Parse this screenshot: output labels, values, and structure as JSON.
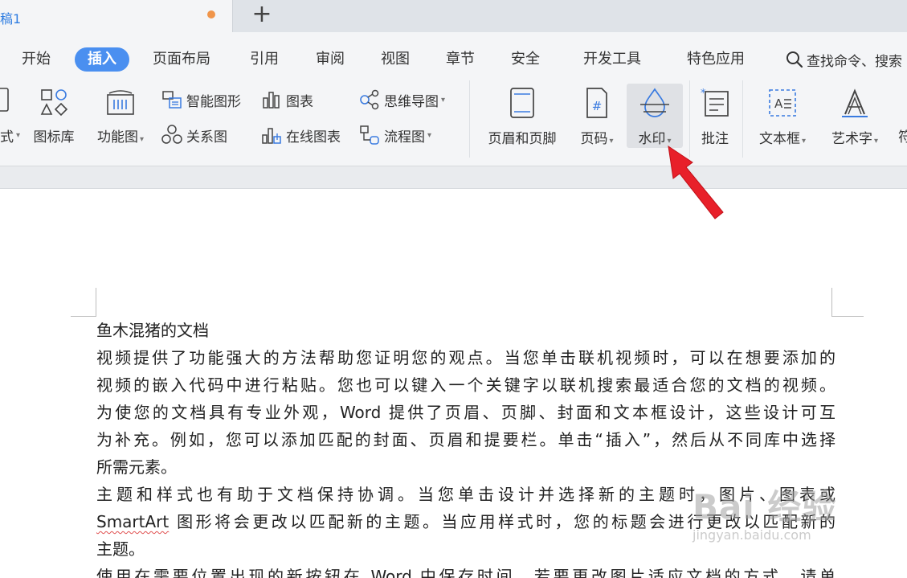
{
  "tabbar": {
    "doc_tab_label": "稿1",
    "new_tab_glyph": "+"
  },
  "menu": {
    "tabs": [
      "开始",
      "插入",
      "页面布局",
      "引用",
      "审阅",
      "视图",
      "章节",
      "安全",
      "开发工具",
      "特色应用"
    ],
    "active_tab": "插入",
    "search_label": "查找命令、搜索"
  },
  "toolbar": {
    "partial_left_label": "式",
    "icon_library": "图标库",
    "function_chart": "功能图",
    "smart_art": "智能图形",
    "chart": "图表",
    "relation_chart": "关系图",
    "online_chart": "在线图表",
    "mind_map": "思维导图",
    "flow_chart": "流程图",
    "header_footer": "页眉和页脚",
    "page_number": "页码",
    "watermark": "水印",
    "comment": "批注",
    "text_box": "文本框",
    "word_art": "艺术字",
    "partial_right_label": "符"
  },
  "document": {
    "title": "鱼木混猪的文档",
    "p1_lines": [
      "视频提供了功能强大的方法帮助您证明您的观点。当您单击联机视频时，可以在想要添加的",
      "视频的嵌入代码中进行粘贴。您也可以键入一个关键字以联机搜索最适合您的文档的视频。",
      "为使您的文档具有专业外观，Word 提供了页眉、页脚、封面和文本框设计，这些设计可互",
      "为补充。例如，您可以添加匹配的封面、页眉和提要栏。单击“插入”，然后从不同库中选择",
      "所需元素。"
    ],
    "p2_line1": "主题和样式也有助于文档保持协调。当您单击设计并选择新的主题时，图片、图表或",
    "p2_line2_word": "SmartArt",
    "p2_line2_rest": " 图形将会更改以匹配新的主题。当应用样式时，您的标题会进行更改以匹配新的",
    "p2_line3": "主题。",
    "p3_line1": "使用在需要位置出现的新按钮在 Word 中保存时间。若要更改图片适应文档的方式，请单"
  },
  "watermark_overlay": {
    "logo": "Bai 经验",
    "url": "jingyan.baidu.com"
  },
  "colors": {
    "accent": "#4a8ff0",
    "arrow": "#e8202a",
    "modified_dot": "#f0954a"
  }
}
